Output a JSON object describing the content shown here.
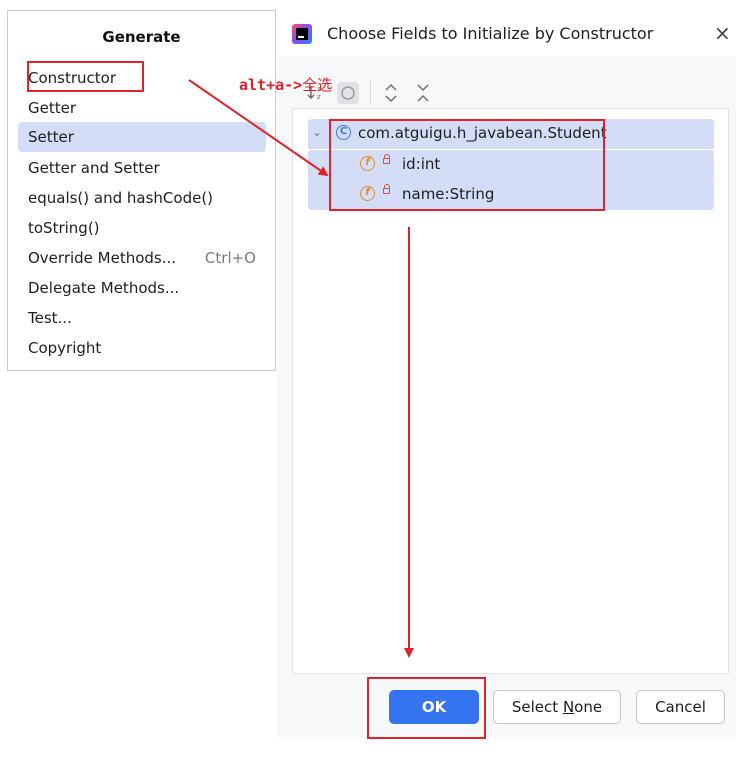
{
  "generate_menu": {
    "title": "Generate",
    "items": [
      {
        "label": "Constructor",
        "shortcut": ""
      },
      {
        "label": "Getter",
        "shortcut": ""
      },
      {
        "label": "Setter",
        "shortcut": ""
      },
      {
        "label": "Getter and Setter",
        "shortcut": ""
      },
      {
        "label": "equals() and hashCode()",
        "shortcut": ""
      },
      {
        "label": "toString()",
        "shortcut": ""
      },
      {
        "label": "Override Methods...",
        "shortcut": "Ctrl+O"
      },
      {
        "label": "Delegate Methods...",
        "shortcut": ""
      },
      {
        "label": "Test...",
        "shortcut": ""
      },
      {
        "label": "Copyright",
        "shortcut": ""
      }
    ],
    "selected_index": 2
  },
  "dialog": {
    "title": "Choose Fields to Initialize by Constructor",
    "toolbar": [
      "sort-alpha-icon",
      "select-all-icon",
      "expand-all-icon",
      "collapse-all-icon"
    ],
    "tree": {
      "class_name": "com.atguigu.h_javabean.Student",
      "fields": [
        "id:int",
        "name:String"
      ]
    },
    "buttons": {
      "ok": "OK",
      "select_none_prefix": "Select ",
      "select_none_mnemonic": "N",
      "select_none_suffix": "one",
      "cancel": "Cancel"
    }
  },
  "annotation": {
    "shortcut_text": "alt+a->",
    "meaning_text": "全选",
    "color": "#e0222a"
  },
  "colors": {
    "selection": "#d3ddf7",
    "primary_button": "#3574f0"
  }
}
